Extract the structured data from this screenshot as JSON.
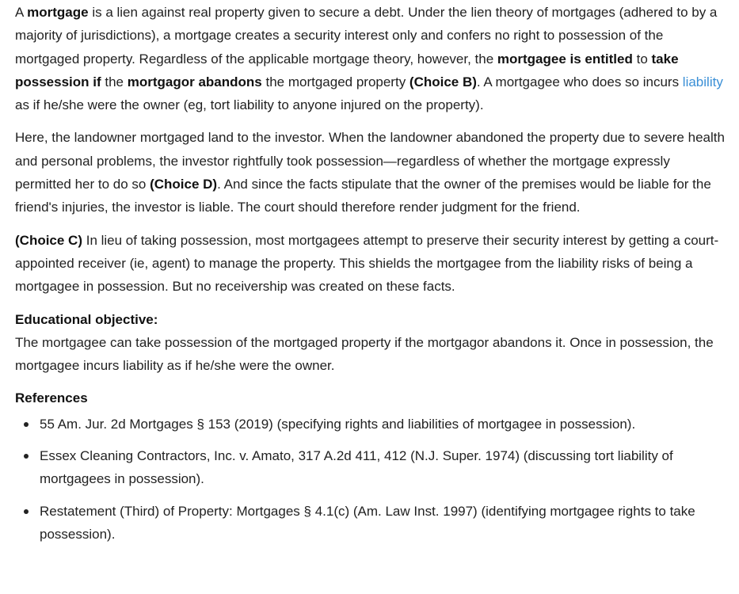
{
  "p1": {
    "t1": "A ",
    "b1": "mortgage",
    "t2": " is a lien against real property given to secure a debt.  Under the lien theory of mortgages (adhered to by a majority of jurisdictions), a mortgage creates a security interest only and confers no right to possession of the mortgaged property.  Regardless of the applicable mortgage theory, however, the ",
    "b2": "mortgagee is entitled",
    "t3": " to ",
    "b3": "take possession if",
    "t4": " the ",
    "b4": "mortgagor abandons",
    "t5": " the mortgaged property ",
    "b5": "(Choice B)",
    "t6": ".  A mortgagee who does so incurs ",
    "link": "liability",
    "t7": " as if he/she were the owner (eg, tort liability to anyone injured on the property)."
  },
  "p2": {
    "t1": "Here, the landowner mortgaged land to the investor.  When the landowner abandoned the property due to severe health and personal problems, the investor rightfully took possession—regardless of whether the mortgage expressly permitted her to do so ",
    "b1": "(Choice D)",
    "t2": ".  And since the facts stipulate that the owner of the premises would be liable for the friend's injuries, the investor is liable.  The court should therefore render judgment for the friend."
  },
  "p3": {
    "b1": "(Choice C)",
    "t1": "  In lieu of taking possession, most mortgagees attempt to preserve their security interest by getting a court-appointed receiver (ie, agent) to manage the property.  This shields the mortgagee from the liability risks of being a mortgagee in possession.  But no receivership was created on these facts."
  },
  "objective": {
    "title": "Educational objective:",
    "text": "The mortgagee can take possession of the mortgaged property if the mortgagor abandons it.  Once in possession, the mortgagee incurs liability as if he/she were the owner."
  },
  "references": {
    "title": "References",
    "items": [
      "55 Am. Jur. 2d Mortgages § 153 (2019) (specifying rights and liabilities of mortgagee in possession).",
      "Essex Cleaning Contractors, Inc. v. Amato, 317 A.2d 411, 412 (N.J. Super. 1974) (discussing tort liability of mortgagees in possession).",
      "Restatement (Third) of Property: Mortgages § 4.1(c) (Am. Law Inst. 1997) (identifying mortgagee rights to take possession)."
    ]
  },
  "colors": {
    "text": "#222222",
    "link": "#3a8fd6"
  }
}
